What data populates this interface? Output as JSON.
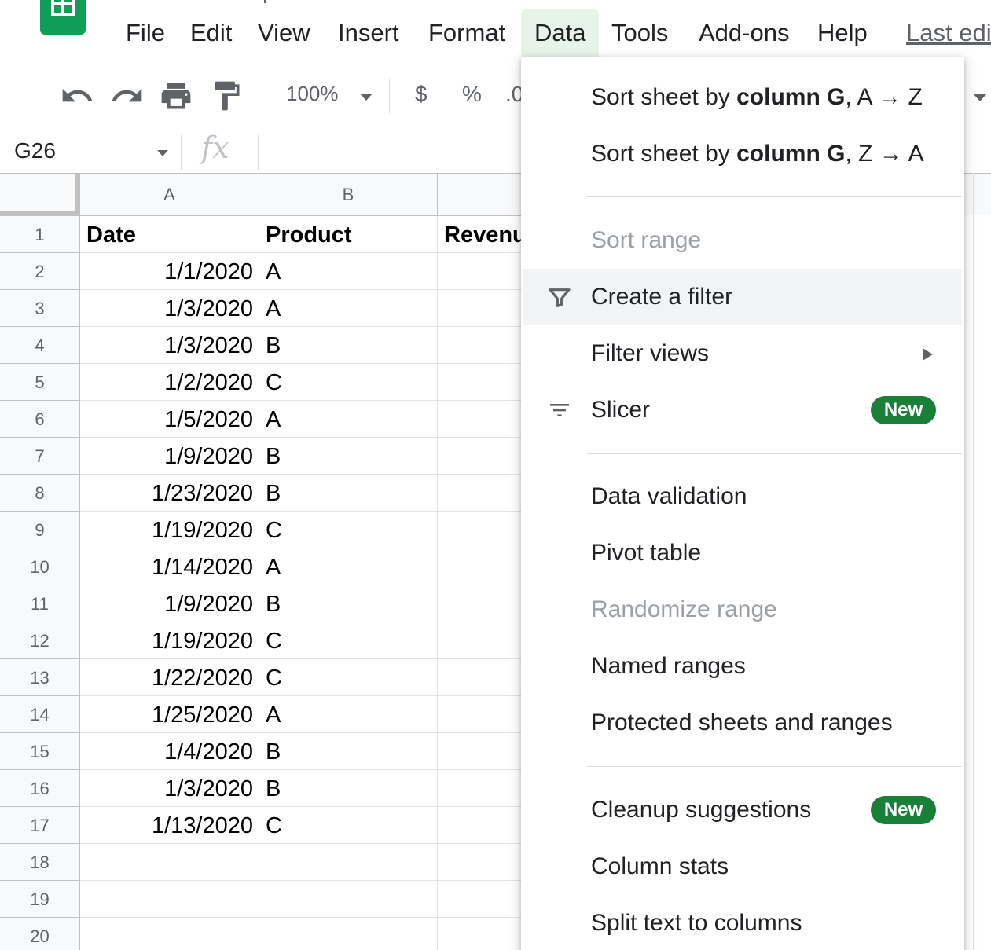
{
  "menubar": {
    "items": [
      "File",
      "Edit",
      "View",
      "Insert",
      "Format",
      "Data",
      "Tools",
      "Add-ons",
      "Help"
    ],
    "active": "Data",
    "last_edit": "Last edi"
  },
  "toolbar": {
    "zoom": "100%",
    "currency": "$",
    "percent": "%",
    "decimal": ".0"
  },
  "formula_bar": {
    "name_box": "G26",
    "fx": "fx"
  },
  "sheet": {
    "columns": [
      "A",
      "B",
      ""
    ],
    "headers": [
      "Date",
      "Product",
      "Revenu"
    ],
    "row_numbers": [
      "1",
      "2",
      "3",
      "4",
      "5",
      "6",
      "7",
      "8",
      "9",
      "10",
      "11",
      "12",
      "13",
      "14",
      "15",
      "16",
      "17",
      "18",
      "19",
      "20"
    ],
    "rows": [
      [
        "1/1/2020",
        "A"
      ],
      [
        "1/3/2020",
        "A"
      ],
      [
        "1/3/2020",
        "B"
      ],
      [
        "1/2/2020",
        "C"
      ],
      [
        "1/5/2020",
        "A"
      ],
      [
        "1/9/2020",
        "B"
      ],
      [
        "1/23/2020",
        "B"
      ],
      [
        "1/19/2020",
        "C"
      ],
      [
        "1/14/2020",
        "A"
      ],
      [
        "1/9/2020",
        "B"
      ],
      [
        "1/19/2020",
        "C"
      ],
      [
        "1/22/2020",
        "C"
      ],
      [
        "1/25/2020",
        "A"
      ],
      [
        "1/4/2020",
        "B"
      ],
      [
        "1/3/2020",
        "B"
      ],
      [
        "1/13/2020",
        "C"
      ]
    ]
  },
  "data_menu": {
    "sort_az": {
      "prefix": "Sort sheet by ",
      "bold": "column G",
      "suffix": ", A → Z"
    },
    "sort_za": {
      "prefix": "Sort sheet by ",
      "bold": "column G",
      "suffix": ", Z → A"
    },
    "sort_range": "Sort range",
    "create_filter": "Create a filter",
    "filter_views": "Filter views",
    "slicer": "Slicer",
    "new_badge": "New",
    "data_validation": "Data validation",
    "pivot_table": "Pivot table",
    "randomize_range": "Randomize range",
    "named_ranges": "Named ranges",
    "protected": "Protected sheets and ranges",
    "cleanup": "Cleanup suggestions",
    "column_stats": "Column stats",
    "split_text": "Split text to columns"
  },
  "colors": {
    "logo_green": "#0f9d58",
    "badge_green": "#188038",
    "active_menu_bg": "#e6f4ea",
    "hover_bg": "#f1f3f4",
    "disabled_text": "#9aa0a6"
  }
}
